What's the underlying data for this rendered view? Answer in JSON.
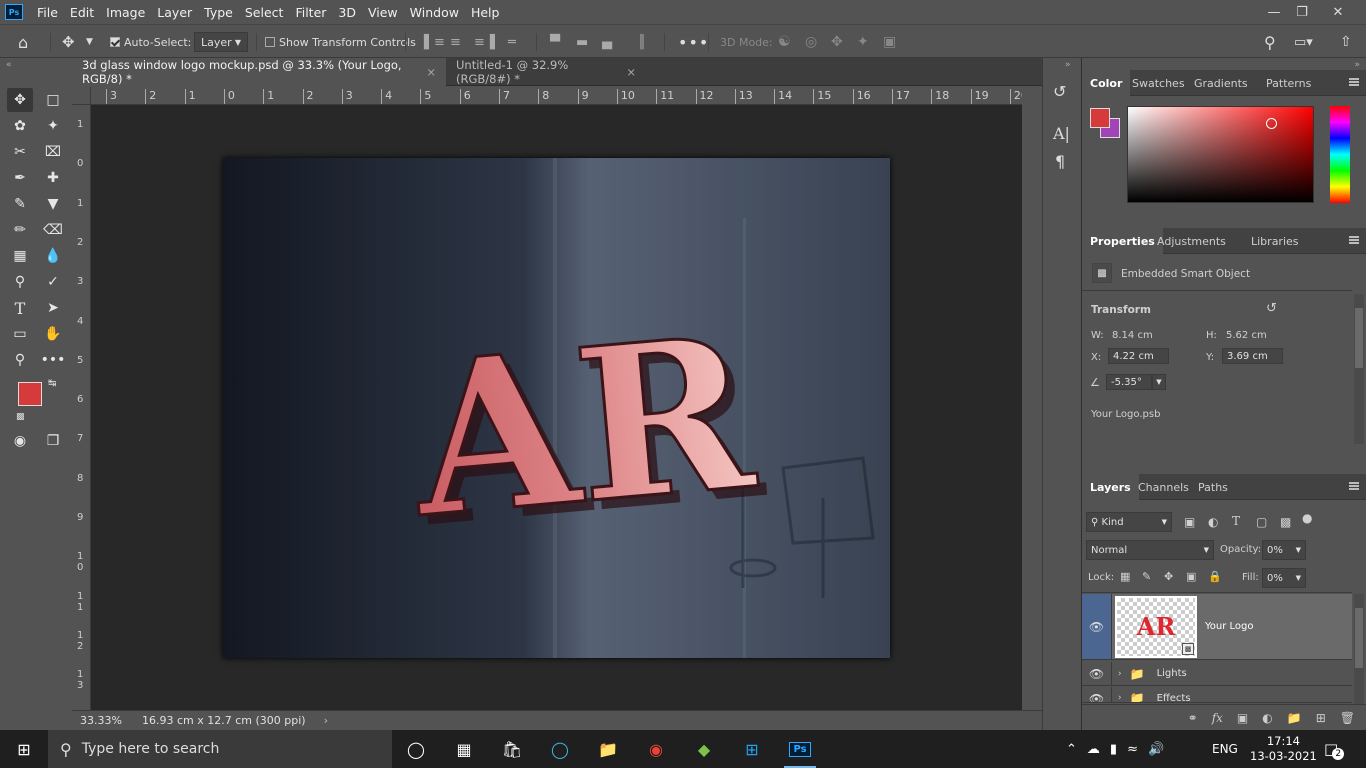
{
  "app": {
    "icon_label": "Ps"
  },
  "menu": [
    "File",
    "Edit",
    "Image",
    "Layer",
    "Type",
    "Select",
    "Filter",
    "3D",
    "View",
    "Window",
    "Help"
  ],
  "options": {
    "auto_select_label": "Auto-Select:",
    "auto_select_target": "Layer",
    "show_transform_label": "Show Transform Controls",
    "mode_3d_label": "3D Mode:"
  },
  "tabs": [
    {
      "label": "3d glass window logo mockup.psd @ 33.3% (Your Logo, RGB/8) *",
      "close": "×"
    },
    {
      "label": "Untitled-1 @ 32.9% (RGB/8#) *",
      "close": "×"
    }
  ],
  "ruler_top": [
    "3",
    "2",
    "1",
    "0",
    "1",
    "2",
    "3",
    "4",
    "5",
    "6",
    "7",
    "8",
    "9",
    "10",
    "11",
    "12",
    "13",
    "14",
    "15",
    "16",
    "17",
    "18",
    "19",
    "20"
  ],
  "ruler_left": [
    "1",
    "0",
    "1",
    "2",
    "3",
    "4",
    "5",
    "6",
    "7",
    "8",
    "9",
    "1\n0",
    "1\n1",
    "1\n2",
    "1\n3"
  ],
  "logo_text": "AR",
  "status": {
    "zoom": "33.33%",
    "doc_info": "16.93 cm x 12.7 cm (300 ppi)"
  },
  "color_panel": {
    "tabs": [
      "Color",
      "Swatches",
      "Gradients",
      "Patterns"
    ],
    "foreground": "#d63a3a",
    "background": "#a044b8"
  },
  "properties": {
    "tabs": [
      "Properties",
      "Adjustments",
      "Libraries"
    ],
    "object_type": "Embedded Smart Object",
    "transform_label": "Transform",
    "w_label": "W:",
    "w": "8.14 cm",
    "h_label": "H:",
    "h": "5.62 cm",
    "x_label": "X:",
    "x": "4.22 cm",
    "y_label": "Y:",
    "y": "3.69 cm",
    "angle": "-5.35°",
    "file": "Your Logo.psb"
  },
  "layers": {
    "tabs": [
      "Layers",
      "Channels",
      "Paths"
    ],
    "filter_kind": "Kind",
    "blend_mode": "Normal",
    "opacity_label": "Opacity:",
    "opacity": "0%",
    "lock_label": "Lock:",
    "fill_label": "Fill:",
    "fill": "0%",
    "items": [
      {
        "name": "Your Logo",
        "thumb": "AR"
      },
      {
        "name": "Lights"
      },
      {
        "name": "Effects"
      }
    ]
  },
  "taskbar": {
    "search_placeholder": "Type here to search",
    "lang": "ENG",
    "time": "17:14",
    "date": "13-03-2021",
    "notif_count": "2"
  }
}
